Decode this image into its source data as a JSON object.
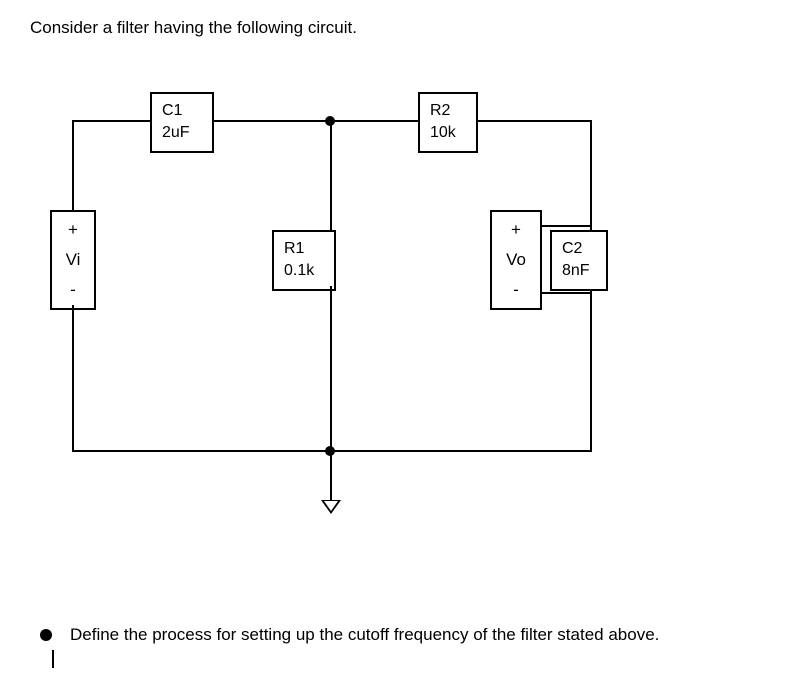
{
  "prompt": "Consider a filter having the following circuit.",
  "question": "Define the process for setting up the cutoff frequency of the filter stated above.",
  "ports": {
    "vi": {
      "plus": "+",
      "name": "Vi",
      "minus": "-"
    },
    "vo": {
      "plus": "+",
      "name": "Vo",
      "minus": "-"
    }
  },
  "components": {
    "C1": {
      "label": "C1",
      "value": "2uF"
    },
    "R1": {
      "label": "R1",
      "value": "0.1k"
    },
    "R2": {
      "label": "R2",
      "value": "10k"
    },
    "C2": {
      "label": "C2",
      "value": "8nF"
    }
  },
  "chart_data": {
    "type": "diagram",
    "topology": "two-stage-passive-filter",
    "stages": [
      {
        "series": "C1",
        "shunt": "R1",
        "type": "high-pass",
        "C_uF": 2,
        "R_ohm": 100
      },
      {
        "series": "R2",
        "shunt": "C2",
        "type": "low-pass",
        "R_ohm": 10000,
        "C_nF": 8
      }
    ],
    "input": "Vi",
    "output": "Vo",
    "nodes": [
      "Vi+",
      "n1",
      "Vo+",
      "gnd"
    ],
    "edges": [
      {
        "from": "Vi+",
        "to": "n1",
        "element": "C1",
        "value": "2uF"
      },
      {
        "from": "n1",
        "to": "gnd",
        "element": "R1",
        "value": "0.1k"
      },
      {
        "from": "n1",
        "to": "Vo+",
        "element": "R2",
        "value": "10k"
      },
      {
        "from": "Vo+",
        "to": "gnd",
        "element": "C2",
        "value": "8nF"
      },
      {
        "from": "Vi-",
        "to": "gnd",
        "element": "wire"
      }
    ]
  }
}
